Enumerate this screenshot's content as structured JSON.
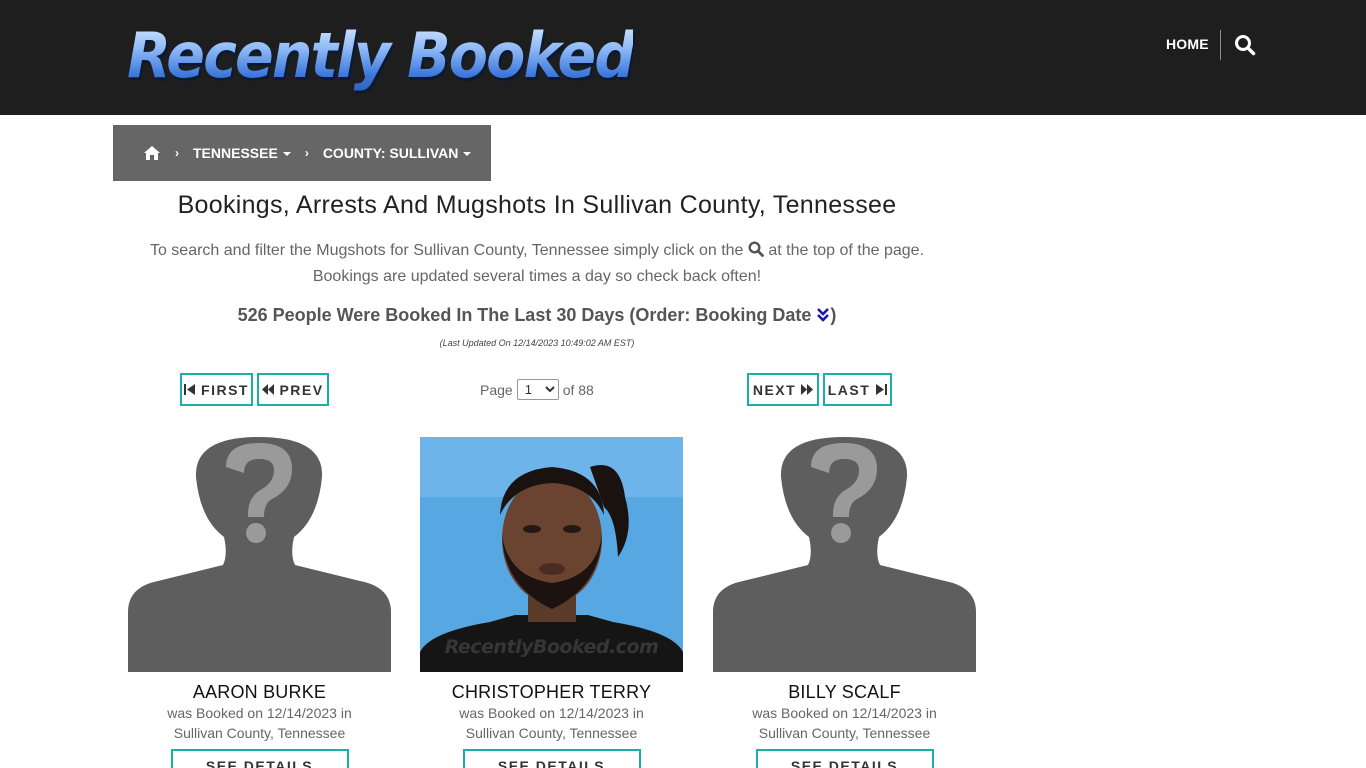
{
  "header": {
    "logo_text": "Recently Booked",
    "nav_home": "HOME",
    "search_icon": "search-icon"
  },
  "breadcrumb": {
    "home_icon": "home-icon",
    "state": "TENNESSEE",
    "county": "COUNTY: SULLIVAN"
  },
  "main": {
    "title": "Bookings, Arrests And Mugshots In Sullivan County, Tennessee",
    "intro_part1": "To search and filter the Mugshots for Sullivan County, Tennessee simply click on the",
    "intro_part2": "at the top of the page.",
    "intro_line2": "Bookings are updated several times a day so check back often!",
    "count_text": "526 People Were Booked In The Last 30 Days (Order: Booking Date",
    "count_close": ")",
    "updated": "(Last Updated On 12/14/2023 10:49:02 AM EST)"
  },
  "pager": {
    "first": "FIRST",
    "prev": "PREV",
    "page_label": "Page",
    "selected_page": "1",
    "of_label": "of 88",
    "next": "NEXT",
    "last": "LAST"
  },
  "cards": [
    {
      "name": "AARON BURKE",
      "booked_line1": "was Booked on 12/14/2023 in",
      "booked_line2": "Sullivan County, Tennessee",
      "button": "SEE DETAILS",
      "photo": "placeholder-silhouette"
    },
    {
      "name": "CHRISTOPHER TERRY",
      "booked_line1": "was Booked on 12/14/2023 in",
      "booked_line2": "Sullivan County, Tennessee",
      "button": "SEE DETAILS",
      "photo": "mugshot",
      "watermark": "RecentlyBooked.com"
    },
    {
      "name": "BILLY SCALF",
      "booked_line1": "was Booked on 12/14/2023 in",
      "booked_line2": "Sullivan County, Tennessee",
      "button": "SEE DETAILS",
      "photo": "placeholder-silhouette"
    }
  ],
  "colors": {
    "header_bg": "#1e1e1e",
    "breadcrumb_bg": "#666666",
    "button_border": "#1ab0a8",
    "logo_blue": "#6fa6f2"
  }
}
